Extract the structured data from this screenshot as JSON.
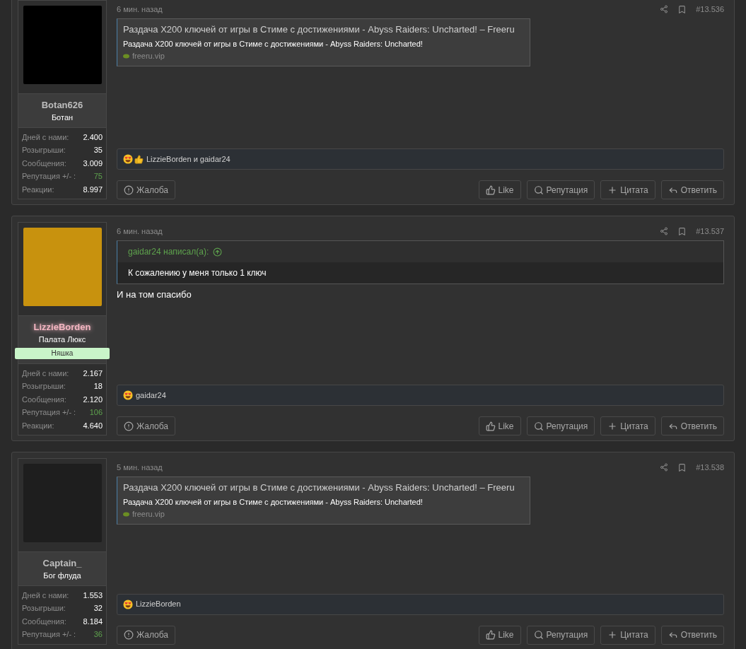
{
  "posts": [
    {
      "time": "6 мин. назад",
      "number": "#13.536",
      "user": {
        "name": "Botan626",
        "color": "#bdbdbd",
        "title": "Ботан",
        "stats": [
          {
            "label": "Дней с нами:",
            "value": "2.400",
            "highlight": false
          },
          {
            "label": "Розыгрыши:",
            "value": "35",
            "highlight": false
          },
          {
            "label": "Сообщения:",
            "value": "3.009",
            "highlight": false
          },
          {
            "label": "Репутация +/- :",
            "value": "75",
            "highlight": true
          },
          {
            "label": "Реакции:",
            "value": "8.997",
            "highlight": false
          }
        ]
      },
      "content": [
        {
          "kind": "link_preview",
          "title": "Раздача X200 ключей от игры в Стиме с достижениями - Abyss Raiders: Uncharted! – Freeru",
          "description": "Раздача X200 ключей от игры в Стиме с достижениями - Abyss Raiders: Uncharted!",
          "domain": "freeru.vip"
        }
      ],
      "reactions": {
        "icons": [
          {
            "kind": "love"
          },
          {
            "kind": "like"
          }
        ],
        "text": "LizzieBorden и gaidar24"
      },
      "buttons": [
        {
          "kind": "report",
          "label": "Жалоба"
        },
        {
          "kind": "like",
          "label": "Like"
        },
        {
          "kind": "reputation",
          "label": "Репутация"
        },
        {
          "kind": "quote",
          "label": "Цитата"
        },
        {
          "kind": "reply",
          "label": "Ответить"
        }
      ]
    },
    {
      "time": "6 мин. назад",
      "number": "#13.537",
      "user": {
        "name": "LizzieBorden",
        "color": "#f4b6c2",
        "title": "Палата Люкс",
        "badge": "Няшка",
        "stats": [
          {
            "label": "Дней с нами:",
            "value": "2.167",
            "highlight": false
          },
          {
            "label": "Розыгрыши:",
            "value": "18",
            "highlight": false
          },
          {
            "label": "Сообщения:",
            "value": "2.120",
            "highlight": false
          },
          {
            "label": "Репутация +/- :",
            "value": "106",
            "highlight": true
          },
          {
            "label": "Реакции:",
            "value": "4.640",
            "highlight": false
          }
        ]
      },
      "content": [
        {
          "kind": "quote",
          "author": "gaidar24 написал(а):",
          "text": "К сожалению у меня только 1 ключ"
        },
        {
          "kind": "text",
          "text": "И на том спасибо"
        }
      ],
      "reactions": {
        "icons": [
          {
            "kind": "love"
          }
        ],
        "text": "gaidar24"
      },
      "buttons": [
        {
          "kind": "report",
          "label": "Жалоба"
        },
        {
          "kind": "like",
          "label": "Like"
        },
        {
          "kind": "reputation",
          "label": "Репутация"
        },
        {
          "kind": "quote",
          "label": "Цитата"
        },
        {
          "kind": "reply",
          "label": "Ответить"
        }
      ]
    },
    {
      "time": "5 мин. назад",
      "number": "#13.538",
      "user": {
        "name": "Captain_",
        "color": "#bdbdbd",
        "title": "Бог флуда",
        "stats": [
          {
            "label": "Дней с нами:",
            "value": "1.553",
            "highlight": false
          },
          {
            "label": "Розыгрыши:",
            "value": "32",
            "highlight": false
          },
          {
            "label": "Сообщения:",
            "value": "8.184",
            "highlight": false
          },
          {
            "label": "Репутация +/- :",
            "value": "36",
            "highlight": true
          }
        ]
      },
      "content": [
        {
          "kind": "link_preview",
          "title": "Раздача X200 ключей от игры в Стиме с достижениями - Abyss Raiders: Uncharted! – Freeru",
          "description": "Раздача X200 ключей от игры в Стиме с достижениями - Abyss Raiders: Uncharted!",
          "domain": "freeru.vip"
        }
      ],
      "reactions": {
        "icons": [
          {
            "kind": "love"
          }
        ],
        "text": "LizzieBorden"
      },
      "buttons": [
        {
          "kind": "report",
          "label": "Жалоба"
        },
        {
          "kind": "like",
          "label": "Like"
        },
        {
          "kind": "reputation",
          "label": "Репутация"
        },
        {
          "kind": "quote",
          "label": "Цитата"
        },
        {
          "kind": "reply",
          "label": "Ответить"
        }
      ]
    }
  ]
}
